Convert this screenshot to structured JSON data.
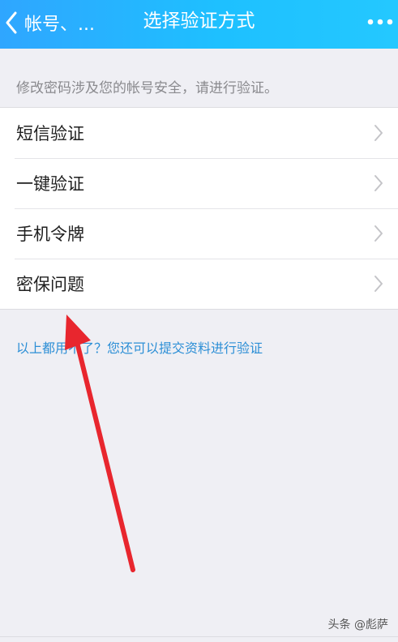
{
  "nav": {
    "back_label": "帐号、...",
    "title": "选择验证方式",
    "more_icon": "more-dots-icon",
    "back_icon": "chevron-left-icon"
  },
  "notice": "修改密码涉及您的帐号安全，请进行验证。",
  "methods": [
    {
      "label": "短信验证"
    },
    {
      "label": "一键验证"
    },
    {
      "label": "手机令牌"
    },
    {
      "label": "密保问题"
    }
  ],
  "alt_link": "以上都用不了？您还可以提交资料进行验证",
  "watermark": "头条 @彪萨",
  "colors": {
    "nav_start": "#2fa6ff",
    "nav_end": "#24c8ff",
    "link": "#2d8fd6",
    "arrow": "#e8262e",
    "background": "#efeff4"
  }
}
